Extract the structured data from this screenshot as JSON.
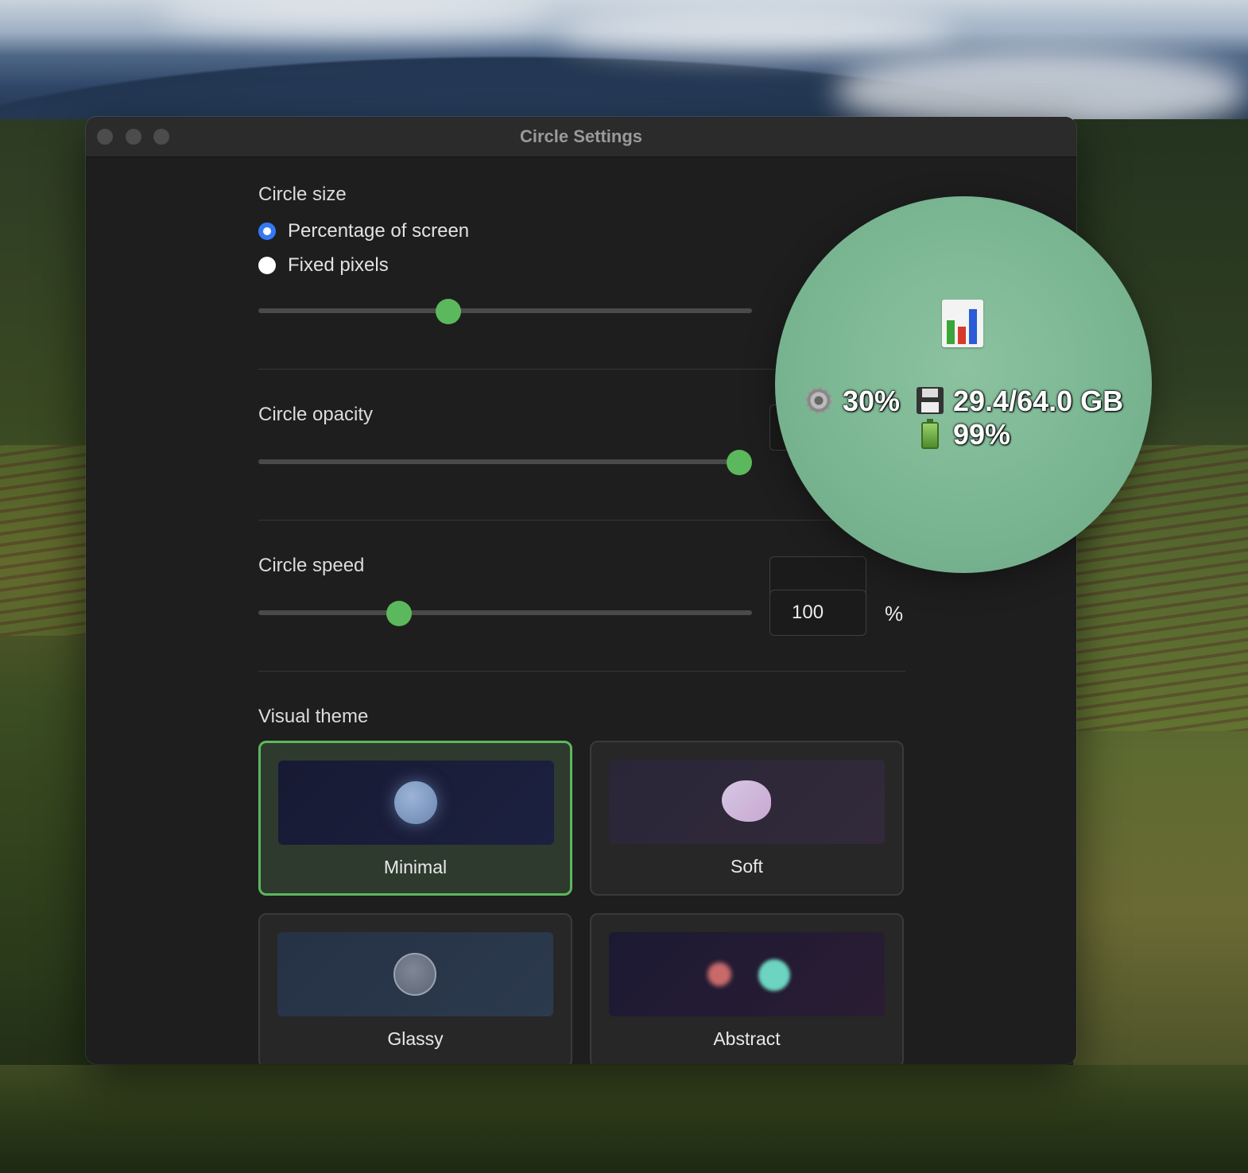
{
  "window": {
    "title": "Circle Settings"
  },
  "circle_size": {
    "label": "Circle size",
    "options": [
      {
        "label": "Percentage of screen",
        "selected": true
      },
      {
        "label": "Fixed pixels",
        "selected": false
      }
    ],
    "slider_fraction": 0.385
  },
  "circle_opacity": {
    "label": "Circle opacity",
    "slider_fraction": 0.975
  },
  "circle_speed": {
    "label": "Circle speed",
    "value": "100",
    "unit": "%",
    "slider_fraction": 0.285
  },
  "visual_theme": {
    "label": "Visual theme",
    "themes": [
      {
        "name": "Minimal",
        "selected": true
      },
      {
        "name": "Soft",
        "selected": false
      },
      {
        "name": "Glassy",
        "selected": false
      },
      {
        "name": "Abstract",
        "selected": false
      }
    ]
  },
  "circle_widget": {
    "cpu": "30%",
    "memory": "29.4/64.0 GB",
    "battery": "99%",
    "icons": [
      "chart-icon",
      "gear-icon",
      "disk-icon",
      "battery-icon"
    ]
  },
  "colors": {
    "accent": "#5cb85c",
    "radio_selected": "#3478f6",
    "window_bg": "#1e1e1e",
    "circle_fill": "#7ab692"
  }
}
